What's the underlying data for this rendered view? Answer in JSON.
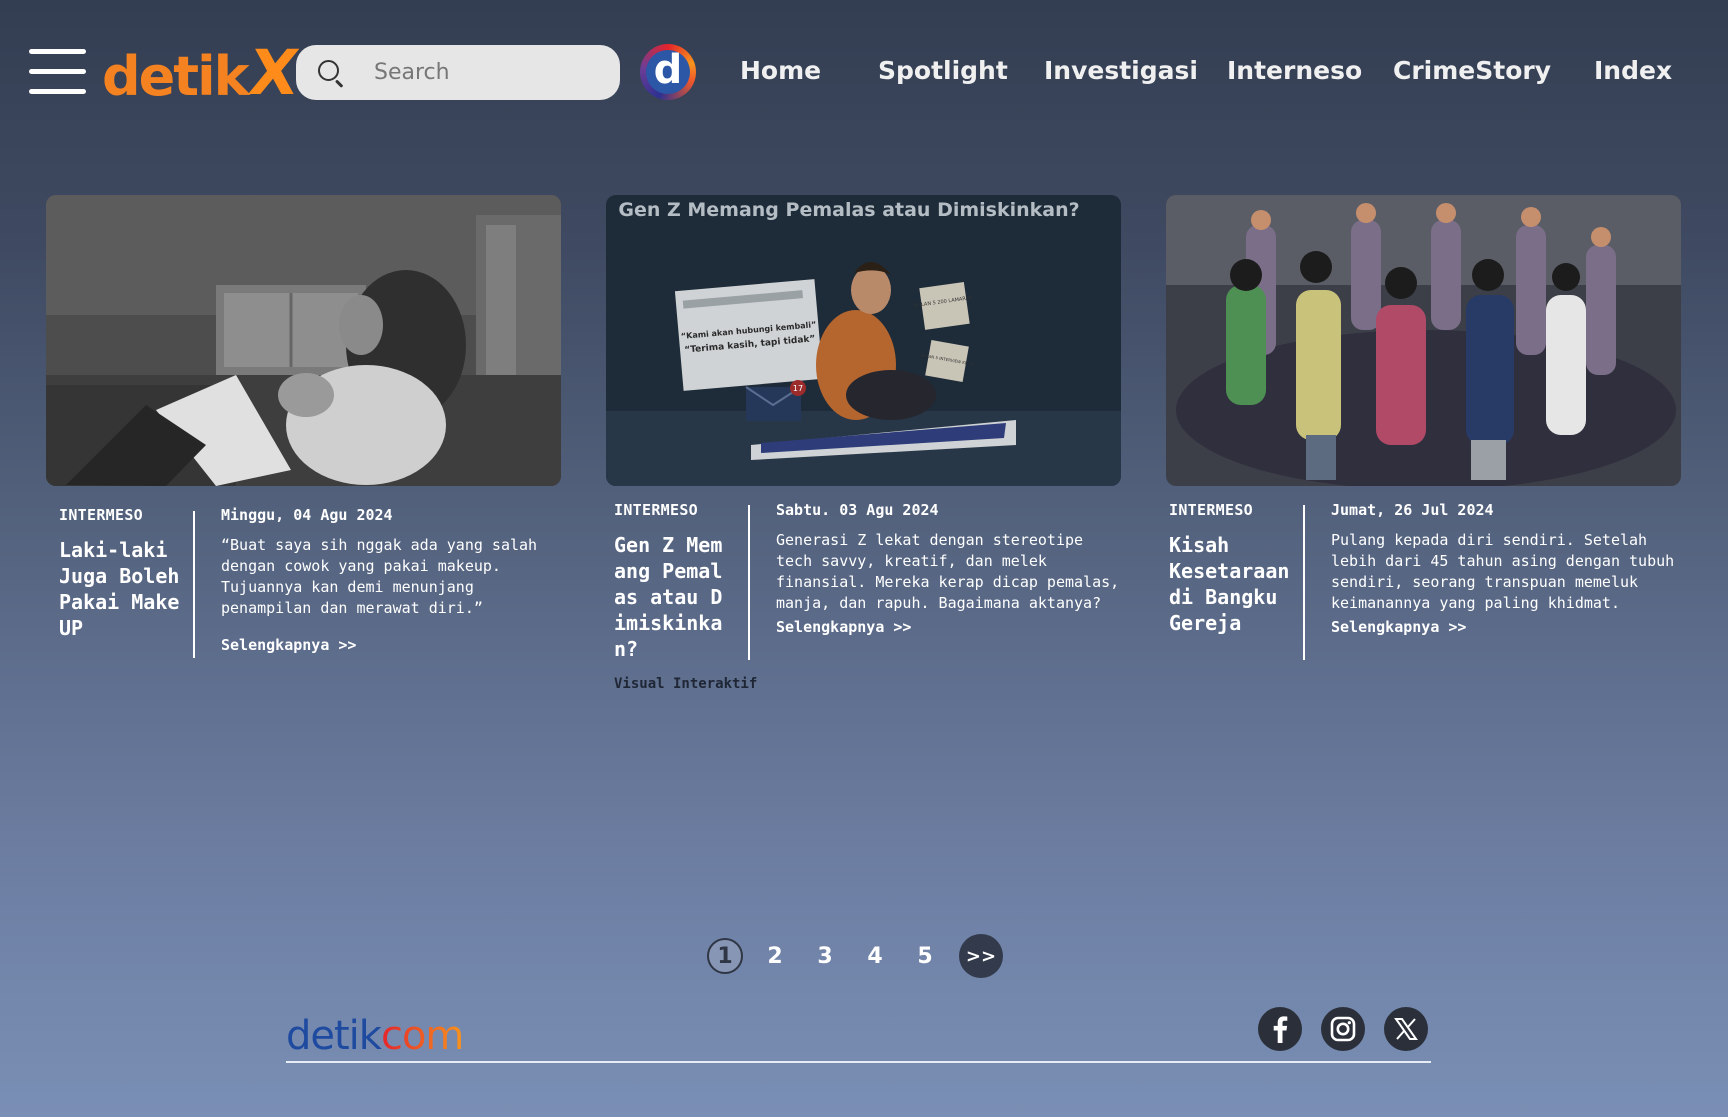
{
  "header": {
    "logo_text": "detik",
    "logo_x": "X",
    "search_placeholder": "Search",
    "d_logo": "d",
    "nav": [
      "Home",
      "Spotlight",
      "Investigasi",
      "Interneso",
      "CrimeStory",
      "Index"
    ]
  },
  "cards": [
    {
      "category": "INTERMESO",
      "title": "Laki-laki Juga Boleh Pakai Make UP",
      "date": "Minggu, 04 Agu 2024",
      "excerpt": "“Buat saya sih nggak ada yang salah dengan cowok yang pakai makeup. Tujuannya kan demi menunjang penampilan dan merawat diri.”",
      "more": "Selengkapnya >>",
      "image": "man-with-cat-reading-photo"
    },
    {
      "category": "INTERMESO",
      "title": "Gen Z Memang Pemalas atau Dimiskinkan?",
      "date": "Sabtu. 03 Agu 2024",
      "excerpt": "Generasi Z lekat dengan stereotipe tech savvy, kreatif, dan melek finansial. Mereka kerap dicap pemalas, manja, dan rapuh. Bagaimana aktanya?",
      "more": "Selengkapnya >>",
      "subtitle": "Visual Interaktif",
      "image": "gen-z-illustration",
      "image_text": {
        "heading": "Gen Z Memang Pemalas atau Dimiskinkan?",
        "note_line1": "“Kami akan hubungi kembali”",
        "note_line2": "“Terima kasih, tapi tidak”",
        "badge": "17",
        "sticky1": "BULAN 5 200 LAMARAN",
        "sticky2": "BULAN 5 INTERVIEW KE-50"
      }
    },
    {
      "category": "INTERMESO",
      "title": "Kisah Kesetaraan di Bangku Gereja",
      "date": "Jumat, 26 Jul 2024",
      "excerpt": "Pulang kepada diri sendiri. Setelah lebih dari 45 tahun asing dengan tubuh sendiri, seorang transpuan memeluk keimanannya yang paling khidmat.",
      "more": "Selengkapnya >>",
      "image": "people-holding-hands-circle-illustration"
    }
  ],
  "pagination": {
    "pages": [
      "1",
      "2",
      "3",
      "4",
      "5"
    ],
    "active": "1",
    "next": ">>"
  },
  "footer": {
    "logo_a": "detik",
    "logo_b": "com",
    "social": [
      "facebook-icon",
      "instagram-icon",
      "x-twitter-icon"
    ]
  },
  "colors": {
    "brand_orange": "#f58220",
    "footer_blue": "#1e4ba0"
  }
}
